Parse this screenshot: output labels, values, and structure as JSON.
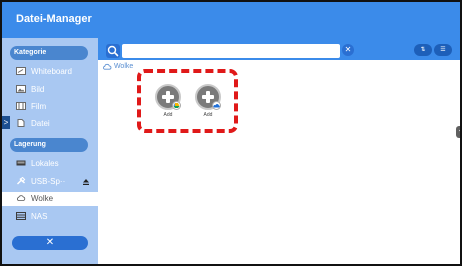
{
  "app": {
    "title": "Datei-Manager"
  },
  "sidebar": {
    "category_header": "Kategorie",
    "category_items": [
      {
        "label": "Whiteboard",
        "icon": "whiteboard-icon"
      },
      {
        "label": "Bild",
        "icon": "image-icon"
      },
      {
        "label": "Film",
        "icon": "film-icon"
      },
      {
        "label": "Datei",
        "icon": "file-icon"
      }
    ],
    "storage_header": "Lagerung",
    "storage_items": [
      {
        "label": "Lokales",
        "icon": "local-drive-icon"
      },
      {
        "label": "USB-Sp··",
        "icon": "usb-icon"
      },
      {
        "label": "Wolke",
        "icon": "cloud-icon",
        "selected": true
      },
      {
        "label": "NAS",
        "icon": "nas-icon"
      }
    ],
    "close_label": "✕",
    "expand_arrow": ">"
  },
  "toolbar": {
    "search_placeholder": "",
    "clear_label": "✕",
    "sort_label": "⇅",
    "view_label": "☰"
  },
  "breadcrumb": {
    "label": "Wolke"
  },
  "content": {
    "add_tiles": [
      {
        "label": "Add",
        "badge": "google-drive-icon"
      },
      {
        "label": "Add",
        "badge": "onedrive-icon"
      }
    ],
    "right_tab": "<"
  },
  "colors": {
    "primary": "#3b8bea",
    "sidebar": "#a9c8f2",
    "header_pill": "#4a86cf",
    "highlight": "#e01919"
  }
}
